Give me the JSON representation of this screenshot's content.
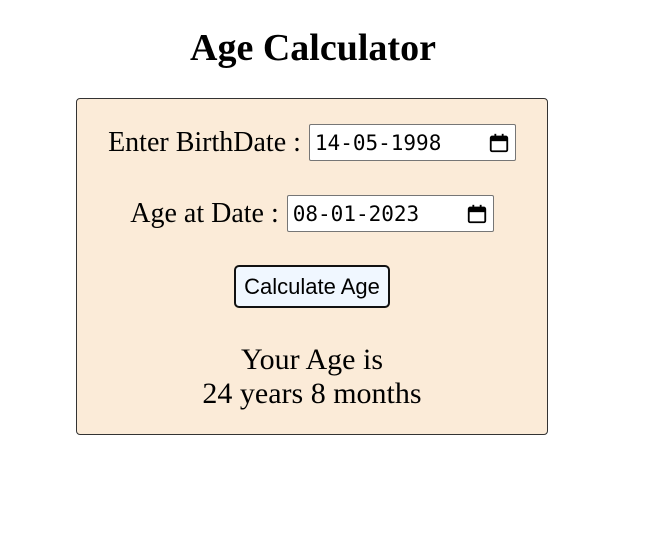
{
  "page": {
    "title": "Age Calculator"
  },
  "form": {
    "birthdate_label": "Enter BirthDate :",
    "birthdate_value": "14-05-1998",
    "atdate_label": "Age at Date :",
    "atdate_value": "08-01-2023",
    "calculate_label": "Calculate Age"
  },
  "result": {
    "heading": "Your Age is",
    "value": "24 years 8 months"
  },
  "colors": {
    "card_background": "#fbebd8",
    "button_background": "#f0f7ff"
  },
  "icons": {
    "date_picker": "calendar-icon"
  }
}
